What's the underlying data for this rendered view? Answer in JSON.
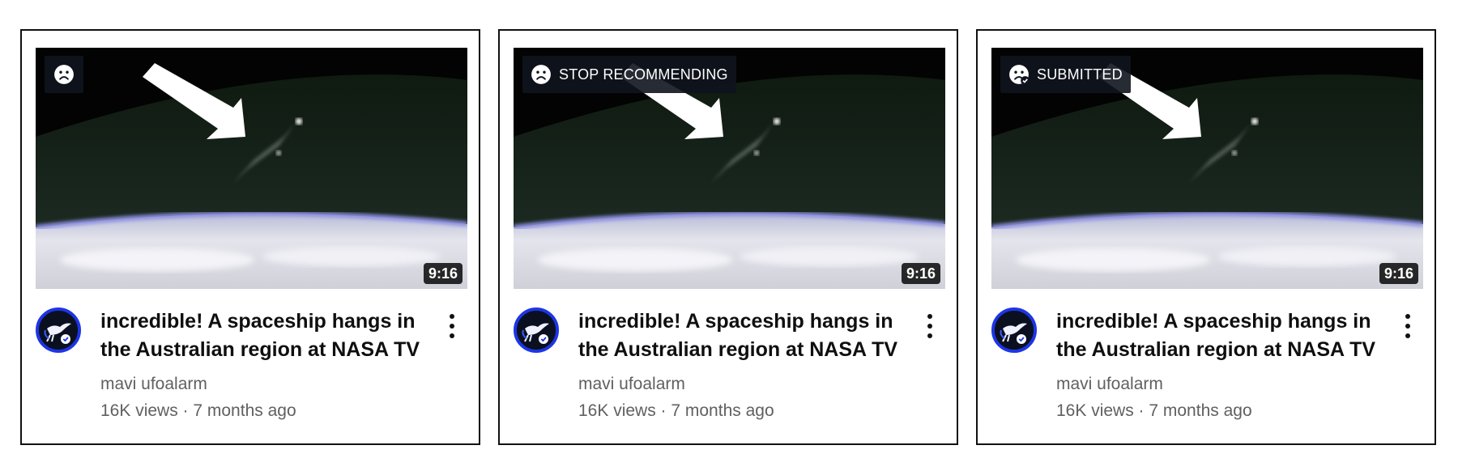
{
  "cards": [
    {
      "overlay": {
        "label": "",
        "icon": "sad-face-icon"
      },
      "duration": "9:16",
      "title": "incredible! A spaceship hangs in the Australian region at NASA TV",
      "channel": "mavi ufoalarm",
      "views": "16K views",
      "age": "7 months ago",
      "meta": "16K views · 7 months ago"
    },
    {
      "overlay": {
        "label": "STOP RECOMMENDING",
        "icon": "sad-face-icon"
      },
      "duration": "9:16",
      "title": "incredible! A spaceship hangs in the Australian region at NASA TV",
      "channel": "mavi ufoalarm",
      "views": "16K views",
      "age": "7 months ago",
      "meta": "16K views · 7 months ago"
    },
    {
      "overlay": {
        "label": "SUBMITTED",
        "icon": "sad-face-check-icon"
      },
      "duration": "9:16",
      "title": "incredible! A spaceship hangs in the Australian region at NASA TV",
      "channel": "mavi ufoalarm",
      "views": "16K views",
      "age": "7 months ago",
      "meta": "16K views · 7 months ago"
    }
  ],
  "colors": {
    "avatar_ring": "#1d35e6",
    "text_secondary": "#606060",
    "overlay_bg": "#0f141e"
  }
}
